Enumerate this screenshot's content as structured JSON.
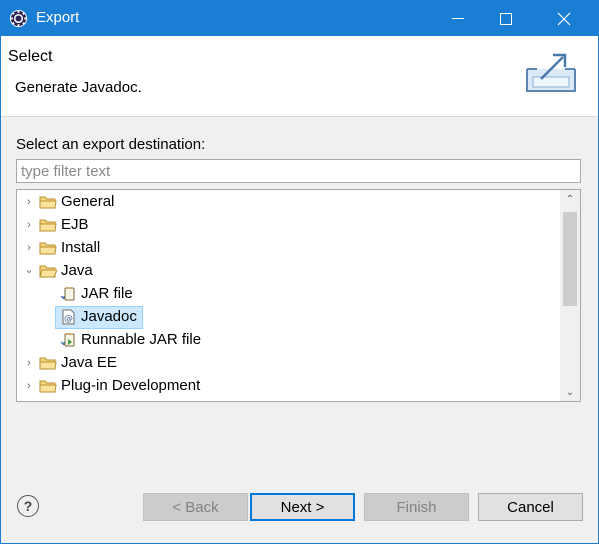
{
  "window": {
    "title": "Export",
    "title_bar_color": "#1a7fd4"
  },
  "header": {
    "title": "Select",
    "description": "Generate Javadoc."
  },
  "main": {
    "prompt": "Select an export destination:",
    "filter_placeholder": "type filter text",
    "filter_value": ""
  },
  "tree": {
    "items": [
      {
        "label": "General",
        "expanded": false,
        "icon": "folder-icon"
      },
      {
        "label": "EJB",
        "expanded": false,
        "icon": "folder-icon"
      },
      {
        "label": "Install",
        "expanded": false,
        "icon": "folder-icon"
      },
      {
        "label": "Java",
        "expanded": true,
        "icon": "folder-icon"
      },
      {
        "label": "JAR file",
        "icon": "jar-icon"
      },
      {
        "label": "Javadoc",
        "icon": "javadoc-icon",
        "selected": true
      },
      {
        "label": "Runnable JAR file",
        "icon": "runnable-jar-icon"
      },
      {
        "label": "Java EE",
        "expanded": false,
        "icon": "folder-icon"
      },
      {
        "label": "Plug-in Development",
        "expanded": false,
        "icon": "folder-icon"
      }
    ],
    "selection_color": "#cce8ff"
  },
  "buttons": {
    "back": "< Back",
    "next": "Next >",
    "finish": "Finish",
    "cancel": "Cancel"
  }
}
